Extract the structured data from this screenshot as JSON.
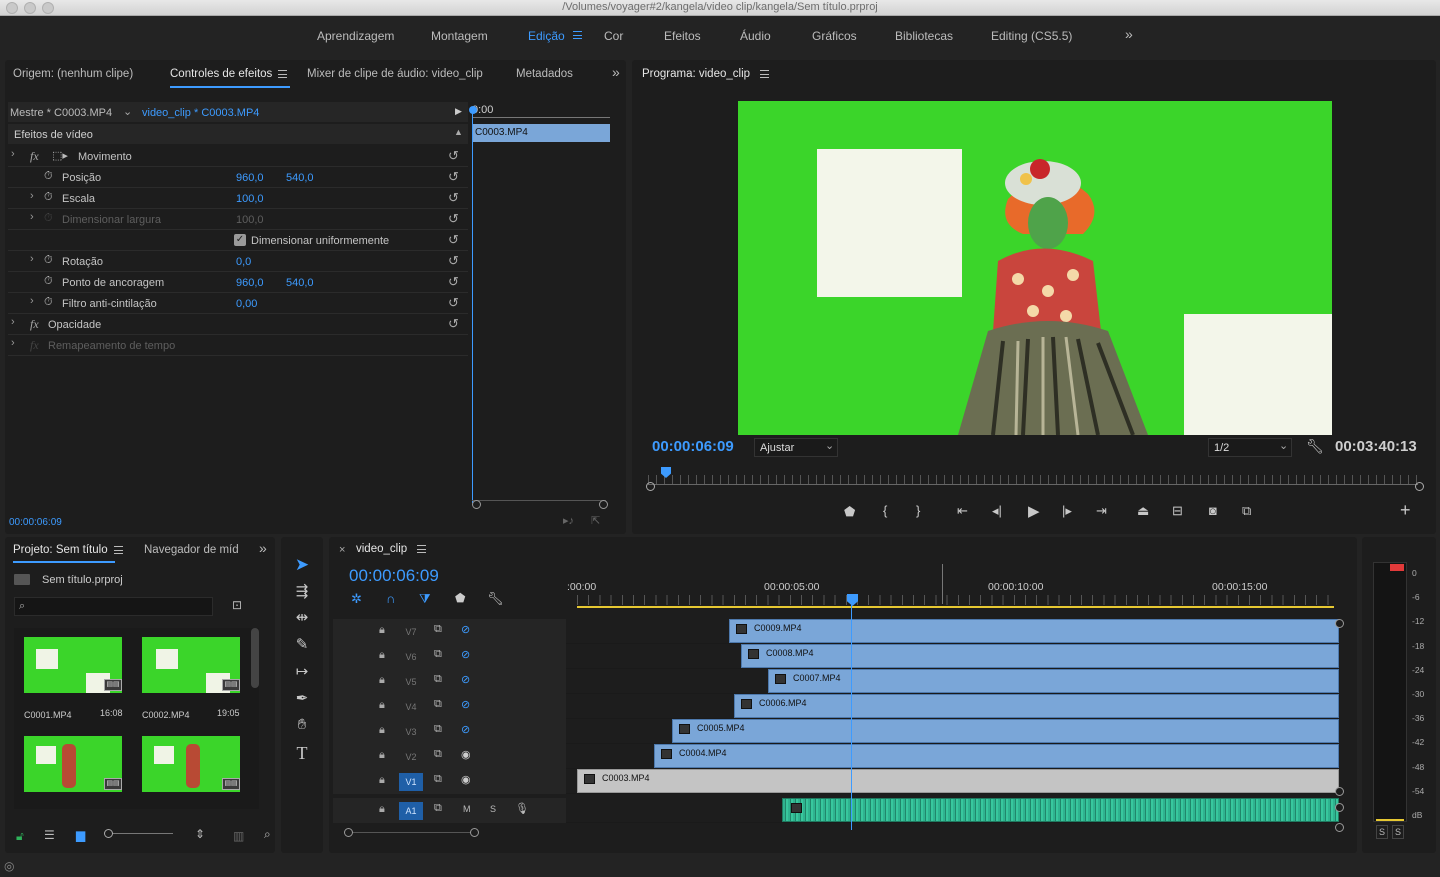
{
  "window": {
    "title": "/Volumes/voyager#2/kangela/video clip/kangela/Sem título.prproj"
  },
  "workspaces": [
    "Aprendizagem",
    "Montagem",
    "Edição",
    "Cor",
    "Efeitos",
    "Áudio",
    "Gráficos",
    "Bibliotecas",
    "Editing (CS5.5)"
  ],
  "workspace_active": "Edição",
  "source_panel": {
    "tabs": [
      "Origem: (nenhum clipe)",
      "Controles de efeitos",
      "Mixer de clipe de áudio: video_clip",
      "Metadados"
    ],
    "active_tab": "Controles de efeitos",
    "master": "Mestre * C0003.MP4",
    "sequence_clip": "video_clip * C0003.MP4",
    "ruler_time": "0:00",
    "clip_label": "C0003.MP4",
    "section": "Efeitos de vídeo",
    "timecode": "00:00:06:09",
    "effects": [
      {
        "name": "Movimento",
        "v1": "",
        "v2": ""
      },
      {
        "name": "Posição",
        "v1": "960,0",
        "v2": "540,0"
      },
      {
        "name": "Escala",
        "v1": "100,0",
        "v2": ""
      },
      {
        "name": "Dimensionar largura",
        "v1": "100,0",
        "v2": ""
      },
      {
        "name": "Dimensionar uniformemente",
        "v1": "",
        "v2": ""
      },
      {
        "name": "Rotação",
        "v1": "0,0",
        "v2": ""
      },
      {
        "name": "Ponto de ancoragem",
        "v1": "960,0",
        "v2": "540,0"
      },
      {
        "name": "Filtro anti-cintilação",
        "v1": "0,00",
        "v2": ""
      },
      {
        "name": "Opacidade",
        "v1": "",
        "v2": ""
      },
      {
        "name": "Remapeamento de tempo",
        "v1": "",
        "v2": ""
      }
    ]
  },
  "program": {
    "title": "Programa: video_clip",
    "timecode": "00:00:06:09",
    "fit": "Ajustar",
    "resolution": "1/2",
    "duration": "00:03:40:13"
  },
  "project": {
    "tabs": [
      "Projeto: Sem título",
      "Navegador de míd"
    ],
    "file": "Sem título.prproj",
    "search_placeholder": "",
    "items": [
      {
        "name": "C0001.MP4",
        "duration": "16:08"
      },
      {
        "name": "C0002.MP4",
        "duration": "19:05"
      },
      {
        "name": "",
        "duration": ""
      },
      {
        "name": "",
        "duration": ""
      }
    ]
  },
  "timeline": {
    "sequence": "video_clip",
    "timecode": "00:00:06:09",
    "ruler": [
      ":00:00",
      "00:00:05:00",
      "00:00:10:00",
      "00:00:15:00"
    ],
    "tracks": [
      {
        "id": "V7",
        "clip": "C0009.MP4"
      },
      {
        "id": "V6",
        "clip": "C0008.MP4"
      },
      {
        "id": "V5",
        "clip": "C0007.MP4"
      },
      {
        "id": "V4",
        "clip": "C0006.MP4"
      },
      {
        "id": "V3",
        "clip": "C0005.MP4"
      },
      {
        "id": "V2",
        "clip": "C0004.MP4"
      },
      {
        "id": "V1",
        "clip": "C0003.MP4"
      },
      {
        "id": "A1",
        "clip": ""
      }
    ],
    "audio_labels": {
      "m": "M",
      "s": "S"
    }
  },
  "meter": {
    "scale": [
      "0",
      "-6",
      "-12",
      "-18",
      "-24",
      "-30",
      "-36",
      "-42",
      "-48",
      "-54",
      "dB"
    ],
    "solo": [
      "S",
      "S"
    ]
  },
  "colors": {
    "accent": "#3d9bff",
    "chroma": "#3bd52a",
    "clip": "#7aa6d8",
    "audio": "#2fb38f"
  }
}
